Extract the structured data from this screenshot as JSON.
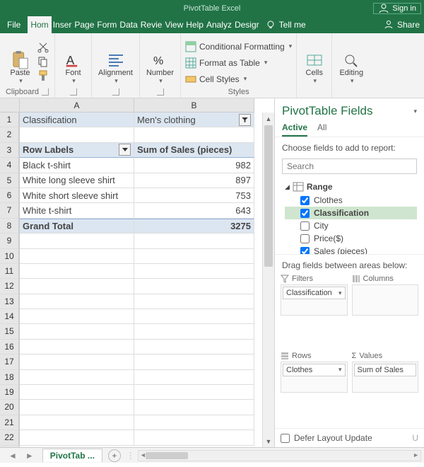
{
  "titlebar": {
    "caption": "PivotTable   Excel",
    "signin": "Sign in"
  },
  "tabs": {
    "file": "File",
    "home": "Hom",
    "insert": "Inser",
    "page": "Page",
    "formulas": "Form",
    "data": "Data",
    "review": "Revie",
    "view": "View",
    "help": "Help",
    "analyze": "Analyz",
    "design": "Desigr",
    "tellme": "Tell me",
    "share": "Share"
  },
  "ribbon": {
    "clipboard": "Clipboard",
    "paste": "Paste",
    "font": "Font",
    "alignment": "Alignment",
    "number": "Number",
    "styles": "Styles",
    "cond_fmt": "Conditional Formatting",
    "as_table": "Format as Table",
    "cell_styles": "Cell Styles",
    "cells": "Cells",
    "editing": "Editing"
  },
  "sheet": {
    "colA": "A",
    "colB": "B",
    "r1A": "Classification",
    "r1B": "Men's clothing",
    "r3A": "Row Labels",
    "r3B": "Sum of Sales (pieces)",
    "rows": [
      {
        "label": "Black t-shirt",
        "value": "982"
      },
      {
        "label": "White long sleeve shirt",
        "value": "897"
      },
      {
        "label": "White short sleeve shirt",
        "value": "753"
      },
      {
        "label": "White t-shirt",
        "value": "643"
      }
    ],
    "grand_label": "Grand Total",
    "grand_value": "3275",
    "tab_name": "PivotTab ..."
  },
  "pane": {
    "title": "PivotTable Fields",
    "tab_active": "Active",
    "tab_all": "All",
    "choose": "Choose fields to add to report:",
    "search_ph": "Search",
    "range": "Range",
    "fields": {
      "clothes": "Clothes",
      "classification": "Classification",
      "city": "City",
      "price": "Price($)",
      "sales": "Sales (pieces)"
    },
    "drag": "Drag fields between areas below:",
    "filters": "Filters",
    "columns": "Columns",
    "rowsA": "Rows",
    "values": "Values",
    "chip_filter": "Classification",
    "chip_rows": "Clothes",
    "chip_values": "Sum of Sales",
    "defer": "Defer Layout Update",
    "update": "U"
  }
}
